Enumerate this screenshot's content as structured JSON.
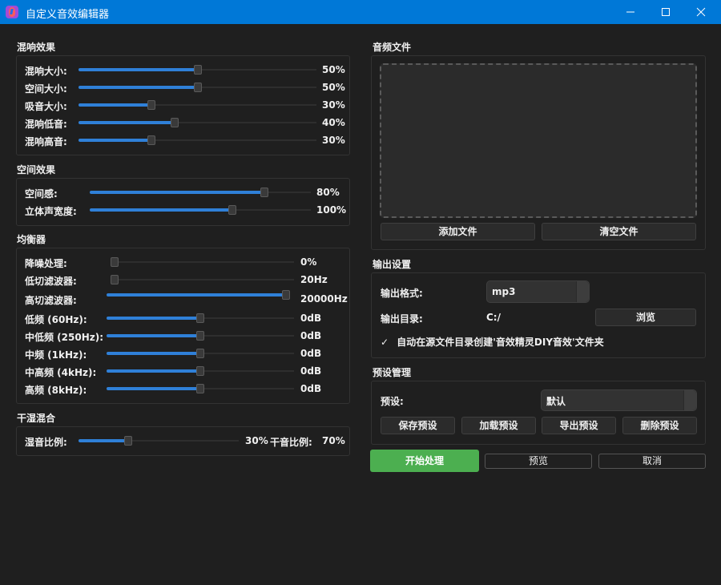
{
  "window": {
    "title": "自定义音效编辑器",
    "icon": "app-logo-icon"
  },
  "colors": {
    "titlebar": "#0078d7",
    "accent": "#2f80d8",
    "primary_button": "#4caf50",
    "background": "#1f1f1f"
  },
  "reverb": {
    "title": "混响效果",
    "rows": [
      {
        "label": "混响大小:",
        "value": "50%",
        "level": 0.5
      },
      {
        "label": "空间大小:",
        "value": "50%",
        "level": 0.5
      },
      {
        "label": "吸音大小:",
        "value": "30%",
        "level": 0.3
      },
      {
        "label": "混响低音:",
        "value": "40%",
        "level": 0.4
      },
      {
        "label": "混响高音:",
        "value": "30%",
        "level": 0.3
      }
    ]
  },
  "spatial": {
    "title": "空间效果",
    "rows": [
      {
        "label": "空间感:",
        "value": "80%",
        "level": 0.8
      },
      {
        "label": "立体声宽度:",
        "value": "100%",
        "level": 0.65
      }
    ]
  },
  "eq": {
    "title": "均衡器",
    "rows": [
      {
        "label": "降噪处理:",
        "value": "0%",
        "level": 0.0
      },
      {
        "label": "低切滤波器:",
        "value": "20Hz",
        "level": 0.0
      },
      {
        "label": "高切滤波器:",
        "value": "20000Hz",
        "level": 1.0
      },
      {
        "label": "低频 (60Hz):",
        "value": "0dB",
        "level": 0.5
      },
      {
        "label": "中低频 (250Hz):",
        "value": "0dB",
        "level": 0.5
      },
      {
        "label": "中频 (1kHz):",
        "value": "0dB",
        "level": 0.5
      },
      {
        "label": "中高频 (4kHz):",
        "value": "0dB",
        "level": 0.5
      },
      {
        "label": "高频 (8kHz):",
        "value": "0dB",
        "level": 0.5
      }
    ]
  },
  "mix": {
    "title": "干湿混合",
    "wet_label": "湿音比例:",
    "wet_value": "30%",
    "wet_level": 0.3,
    "dry_label": "干音比例:",
    "dry_value": "70%"
  },
  "audio_files": {
    "title": "音频文件",
    "add_label": "添加文件",
    "clear_label": "清空文件"
  },
  "output": {
    "title": "输出设置",
    "format_label": "输出格式:",
    "format_value": "mp3",
    "dir_label": "输出目录:",
    "dir_value": "C:/",
    "browse_label": "浏览",
    "auto_folder_label": "自动在源文件目录创建'音效精灵DIY音效'文件夹",
    "auto_folder_checked": true,
    "check_mark": "✓"
  },
  "presets": {
    "title": "预设管理",
    "preset_label": "预设:",
    "preset_value": "默认",
    "save_label": "保存预设",
    "load_label": "加载预设",
    "export_label": "导出预设",
    "delete_label": "删除预设"
  },
  "actions": {
    "start_label": "开始处理",
    "preview_label": "预览",
    "cancel_label": "取消"
  }
}
